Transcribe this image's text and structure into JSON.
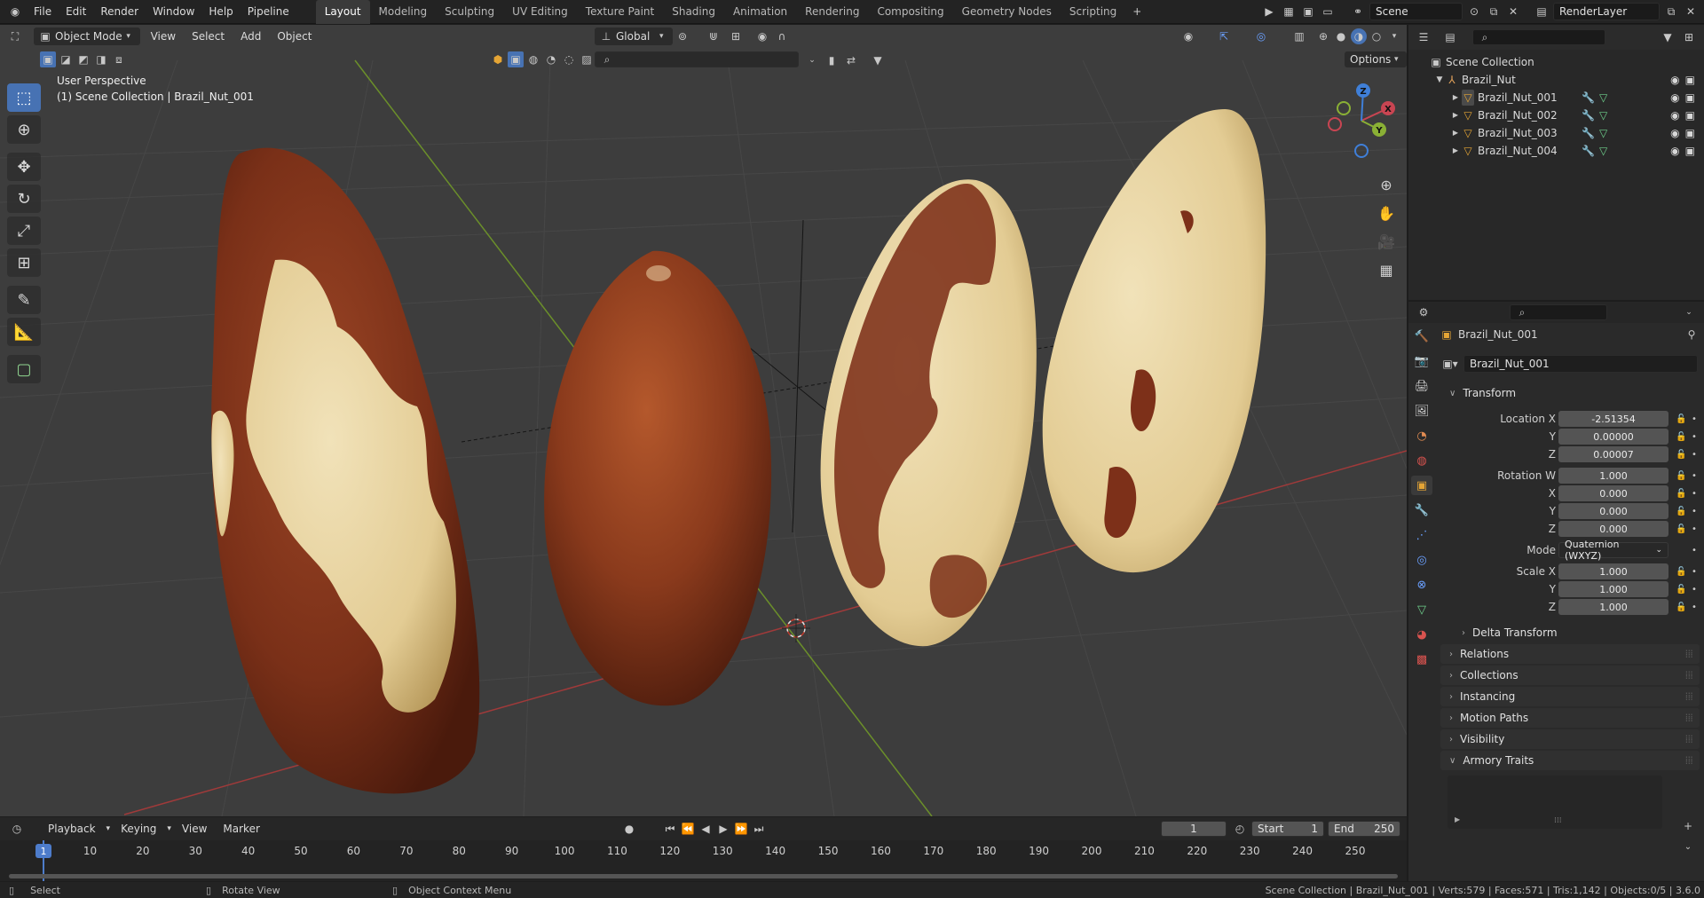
{
  "app": {
    "menus": [
      "File",
      "Edit",
      "Render",
      "Window",
      "Help",
      "Pipeline"
    ],
    "workspaces": [
      "Layout",
      "Modeling",
      "Sculpting",
      "UV Editing",
      "Texture Paint",
      "Shading",
      "Animation",
      "Rendering",
      "Compositing",
      "Geometry Nodes",
      "Scripting"
    ],
    "active_workspace": "Layout",
    "scene": "Scene",
    "render_layer": "RenderLayer"
  },
  "viewport": {
    "mode": "Object Mode",
    "menus": [
      "View",
      "Select",
      "Add",
      "Object"
    ],
    "orientation": "Global",
    "options_label": "Options",
    "perspective": "User Perspective",
    "context": "(1) Scene Collection | Brazil_Nut_001",
    "gizmo_axes": [
      "X",
      "Y",
      "Z"
    ],
    "colors": {
      "bg": "#3d3d3d",
      "grid": "#484848",
      "x_axis": "#a03a3a",
      "y_axis": "#6b8f2a",
      "accent": "#4772b3"
    }
  },
  "outliner": {
    "root": "Scene Collection",
    "collection": "Brazil_Nut",
    "objects": [
      "Brazil_Nut_001",
      "Brazil_Nut_002",
      "Brazil_Nut_003",
      "Brazil_Nut_004"
    ]
  },
  "properties": {
    "object_name": "Brazil_Nut_001",
    "data_name": "Brazil_Nut_001",
    "transform_label": "Transform",
    "location": {
      "label": "Location X",
      "x": "-2.51354",
      "y": "0.00000",
      "z": "0.00007"
    },
    "rotation": {
      "label": "Rotation W",
      "w": "1.000",
      "x": "0.000",
      "y": "0.000",
      "z": "0.000"
    },
    "mode_label": "Mode",
    "mode_value": "Quaternion (WXYZ)",
    "scale": {
      "label": "Scale X",
      "x": "1.000",
      "y": "1.000",
      "z": "1.000"
    },
    "axis_labels": {
      "y": "Y",
      "z": "Z",
      "x": "X"
    },
    "panels": [
      "Delta Transform",
      "Relations",
      "Collections",
      "Instancing",
      "Motion Paths",
      "Visibility"
    ],
    "armory_label": "Armory Traits"
  },
  "timeline": {
    "menus": [
      "Playback",
      "Keying",
      "View",
      "Marker"
    ],
    "current_frame": "1",
    "start_label": "Start",
    "start_value": "1",
    "end_label": "End",
    "end_value": "250",
    "ruler": [
      "1",
      "10",
      "20",
      "30",
      "40",
      "50",
      "60",
      "70",
      "80",
      "90",
      "100",
      "110",
      "120",
      "130",
      "140",
      "150",
      "160",
      "170",
      "180",
      "190",
      "200",
      "210",
      "220",
      "230",
      "240",
      "250"
    ]
  },
  "statusbar": {
    "left": "Select",
    "middle": "Rotate View",
    "right_hint": "Object Context Menu",
    "stats": "Scene Collection | Brazil_Nut_001 | Verts:579 | Faces:571 | Tris:1,142 | Objects:0/5 | 3.6.0"
  }
}
